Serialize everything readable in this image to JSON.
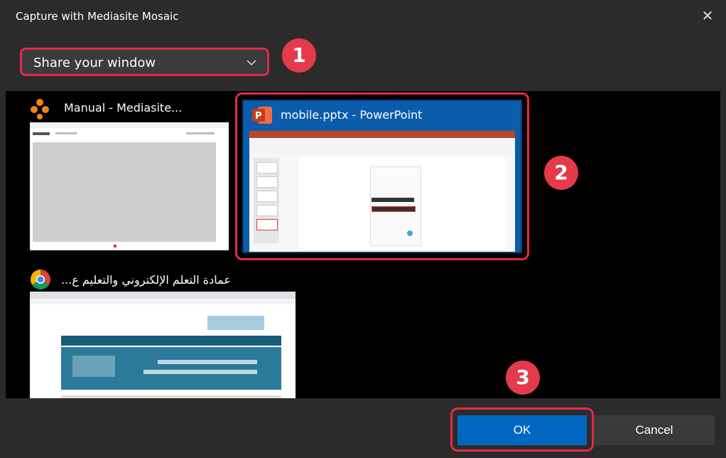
{
  "dialog": {
    "title": "Capture with Mediasite Mosaic",
    "close_icon": "close-icon"
  },
  "share_select": {
    "selected": "Share your window",
    "icon": "chevron-down-icon"
  },
  "annotations": [
    "1",
    "2",
    "3"
  ],
  "windows": [
    {
      "title": "Manual - Mediasite...",
      "icon": "mediasite-mosaic-icon"
    },
    {
      "title": "mobile.pptx - PowerPoint",
      "icon": "powerpoint-icon",
      "selected": true
    },
    {
      "title": "عمادة التعلم الإلكتروني والتعليم ع...",
      "icon": "chrome-icon"
    }
  ],
  "buttons": {
    "ok": "OK",
    "cancel": "Cancel"
  },
  "colors": {
    "accent": "#0067c0",
    "highlight": "#e32b45",
    "selected_tile": "#0b5cab"
  }
}
